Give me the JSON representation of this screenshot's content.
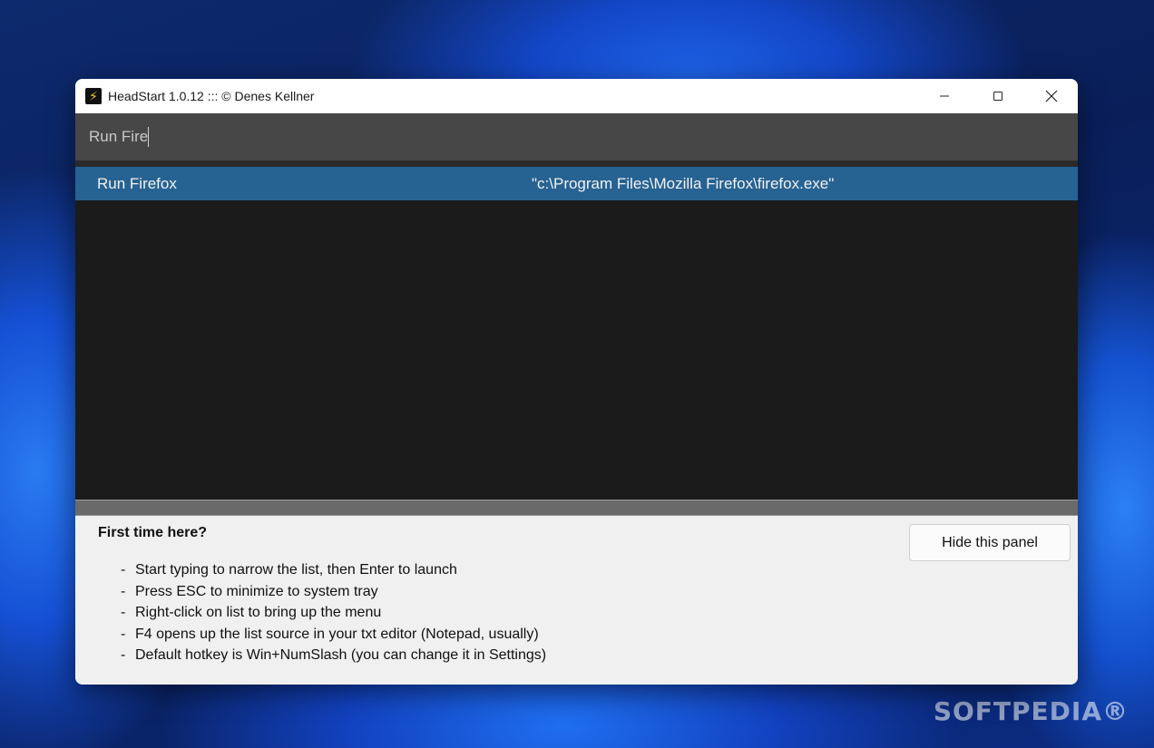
{
  "window": {
    "title": "HeadStart 1.0.12 ::: © Denes Kellner",
    "app_icon": "lightning-icon",
    "controls": [
      "minimize-icon",
      "maximize-icon",
      "close-icon"
    ]
  },
  "search": {
    "value": "Run Fire"
  },
  "results": [
    {
      "name": "Run Firefox",
      "path": "\"c:\\Program Files\\Mozilla Firefox\\firefox.exe\""
    }
  ],
  "help": {
    "title": "First time here?",
    "hide_button": "Hide this panel",
    "items": [
      "Start typing to narrow the list, then Enter to launch",
      "Press ESC to minimize to system tray",
      "Right-click on list to bring up the menu",
      "F4 opens up the list source in your txt editor (Notepad, usually)",
      "Default hotkey is Win+NumSlash (you can change it in Settings)"
    ]
  },
  "watermark": "SOFTPEDIA®",
  "colors": {
    "selection": "#266292",
    "list_bg": "#1b1b1b",
    "search_bg": "#474747",
    "panel_bg": "#f0f0f0"
  }
}
